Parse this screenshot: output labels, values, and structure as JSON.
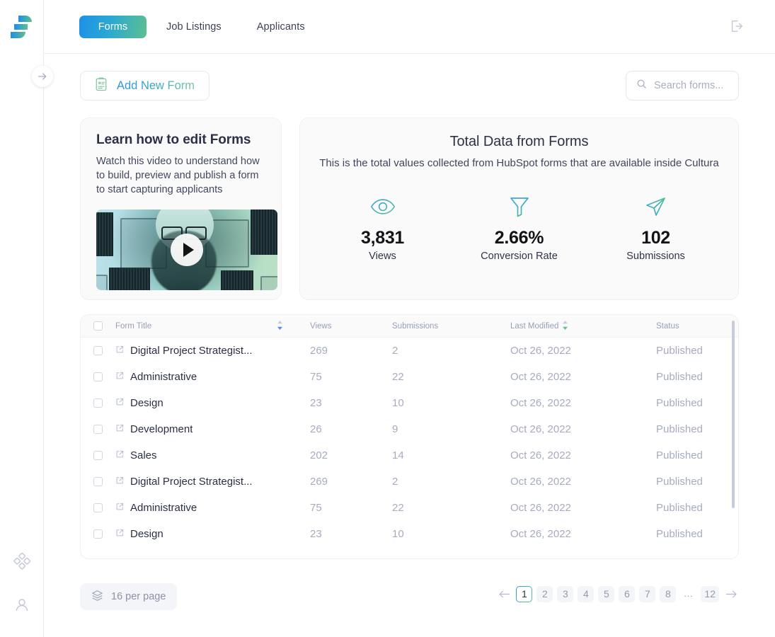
{
  "app": {
    "logo_icon": "cultura-bars-logo",
    "expand_icon": "arrow-right-icon",
    "logout_icon": "logout-icon"
  },
  "nav": {
    "tabs": [
      {
        "label": "Forms",
        "active": true
      },
      {
        "label": "Job Listings",
        "active": false
      },
      {
        "label": "Applicants",
        "active": false
      }
    ]
  },
  "rail": {
    "items": [
      {
        "icon": "apps-grid-icon",
        "name": "sidebar-item-apps"
      },
      {
        "icon": "user-icon",
        "name": "sidebar-item-profile"
      }
    ]
  },
  "toolbar": {
    "add_label": "Add New Form",
    "add_icon": "clipboard-form-icon",
    "search_placeholder": "Search forms...",
    "search_value": "",
    "search_icon": "search-icon"
  },
  "learn_card": {
    "title": "Learn how to edit Forms",
    "description": "Watch this video to understand how to build, preview and publish a form to start capturing applicants",
    "video_play_icon": "play-icon"
  },
  "stats_card": {
    "title": "Total Data from Forms",
    "subtitle": "This is the total values collected from HubSpot forms that are available inside Cultura",
    "kpis": [
      {
        "icon": "eye-icon",
        "value": "3,831",
        "caption": "Views"
      },
      {
        "icon": "funnel-icon",
        "value": "2.66%",
        "caption": "Conversion Rate"
      },
      {
        "icon": "send-icon",
        "value": "102",
        "caption": "Submissions"
      }
    ]
  },
  "table": {
    "columns": [
      {
        "label": "Form Title",
        "sortable": true,
        "sort_color": "#4e8ef0"
      },
      {
        "label": "Views",
        "sortable": false
      },
      {
        "label": "Submissions",
        "sortable": false
      },
      {
        "label": "Last Modified",
        "sortable": true,
        "sort_color": "#5fc08c"
      },
      {
        "label": "Status",
        "sortable": false
      }
    ],
    "rows": [
      {
        "title": "Digital Project Strategist...",
        "views": "269",
        "submissions": "2",
        "modified": "Oct 26, 2022",
        "status": "Published"
      },
      {
        "title": "Administrative",
        "views": "75",
        "submissions": "22",
        "modified": "Oct 26, 2022",
        "status": "Published"
      },
      {
        "title": "Design",
        "views": "23",
        "submissions": "10",
        "modified": "Oct 26, 2022",
        "status": "Published"
      },
      {
        "title": "Development",
        "views": "26",
        "submissions": "9",
        "modified": "Oct 26, 2022",
        "status": "Published"
      },
      {
        "title": "Sales",
        "views": "202",
        "submissions": "14",
        "modified": "Oct 26, 2022",
        "status": "Published"
      },
      {
        "title": "Digital Project Strategist...",
        "views": "269",
        "submissions": "2",
        "modified": "Oct 26, 2022",
        "status": "Published"
      },
      {
        "title": "Administrative",
        "views": "75",
        "submissions": "22",
        "modified": "Oct 26, 2022",
        "status": "Published"
      },
      {
        "title": "Design",
        "views": "23",
        "submissions": "10",
        "modified": "Oct 26, 2022",
        "status": "Published"
      }
    ]
  },
  "footer": {
    "per_page_label": "16 per page",
    "per_page_icon": "layers-icon",
    "prev_icon": "arrow-left-icon",
    "next_icon": "arrow-right-icon",
    "pages": [
      "1",
      "2",
      "3",
      "4",
      "5",
      "6",
      "7",
      "8",
      "...",
      "12"
    ],
    "current_page": "1"
  },
  "colors": {
    "brand_blue": "#1e90e8",
    "brand_green": "#5dc08d",
    "text_dark": "#2c3047",
    "text_muted": "#a7abc0"
  }
}
